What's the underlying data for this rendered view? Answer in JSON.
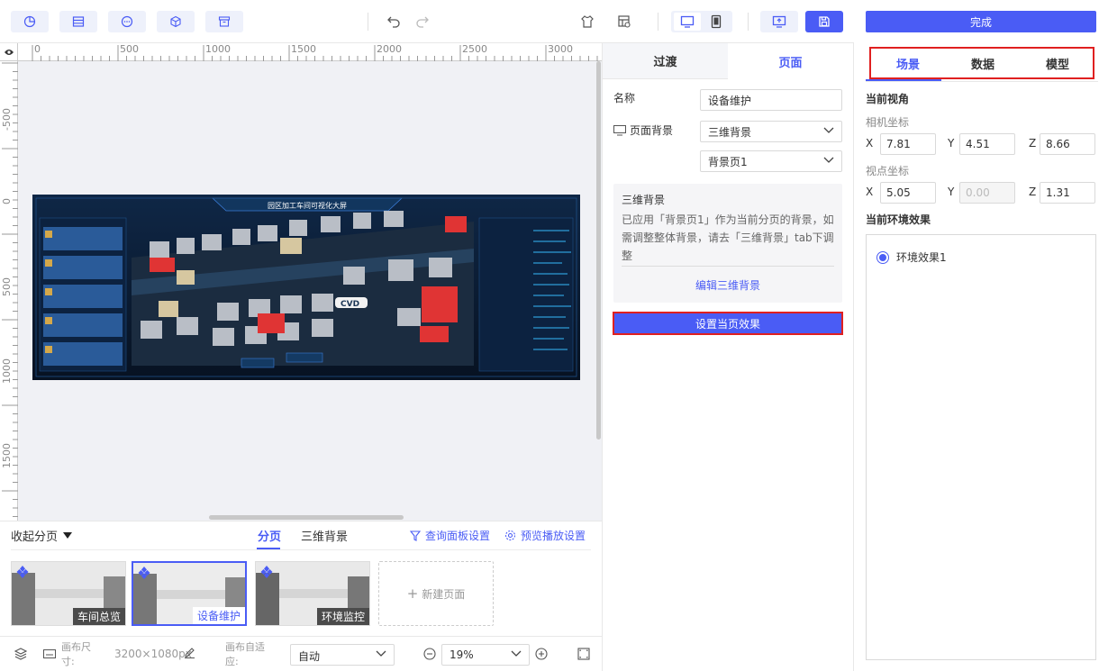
{
  "toolbar": {
    "icons_left": [
      "chart-icon",
      "table-icon",
      "dots-circle-icon",
      "cube-icon",
      "archive-icon"
    ],
    "undo": "undo-icon",
    "redo": "redo-icon"
  },
  "rulers": {
    "horizontal": [
      "0",
      "500",
      "1000",
      "1500",
      "2000",
      "2500",
      "3000"
    ],
    "vertical": [
      "-500",
      "0",
      "500",
      "1000",
      "1500"
    ]
  },
  "preview": {
    "title": "园区加工车间可视化大屏",
    "cvd_badge": "CVD"
  },
  "pages": {
    "collapse_label": "收起分页",
    "tabs": [
      "分页",
      "三维背景"
    ],
    "query_settings": "查询面板设置",
    "preview_settings": "预览播放设置",
    "items": [
      {
        "label": "车间总览",
        "active": false
      },
      {
        "label": "设备维护",
        "active": true
      },
      {
        "label": "环境监控",
        "active": false
      }
    ],
    "new_page": "新建页面"
  },
  "status": {
    "canvas_size_label": "画布尺寸:",
    "canvas_size_value": "3200×1080px",
    "fit_label": "画布自适应:",
    "fit_value": "自动",
    "zoom_value": "19%"
  },
  "mid": {
    "tabs": [
      "过渡",
      "页面"
    ],
    "active_tab": "页面",
    "name_label": "名称",
    "name_value": "设备维护",
    "bg_label": "页面背景",
    "bg_type": "三维背景",
    "bg_page": "背景页1",
    "info_title": "三维背景",
    "info_text": "已应用「背景页1」作为当前分页的背景，如需调整整体背景，请去「三维背景」tab下调整",
    "edit_link": "编辑三维背景",
    "set_effect_button": "设置当页效果"
  },
  "right": {
    "done_button": "完成",
    "tabs": [
      "场景",
      "数据",
      "模型"
    ],
    "active_tab": "场景",
    "view_title": "当前视角",
    "camera_label": "相机坐标",
    "camera": {
      "x": "7.81",
      "y": "4.51",
      "z": "8.66"
    },
    "target_label": "视点坐标",
    "target": {
      "x": "5.05",
      "y": "0.00",
      "z": "1.31"
    },
    "env_title": "当前环境效果",
    "env_option": "环境效果1",
    "axis": {
      "x": "X",
      "y": "Y",
      "z": "Z"
    }
  },
  "colors": {
    "accent": "#4a5cf5",
    "highlight_border": "#e02020"
  }
}
